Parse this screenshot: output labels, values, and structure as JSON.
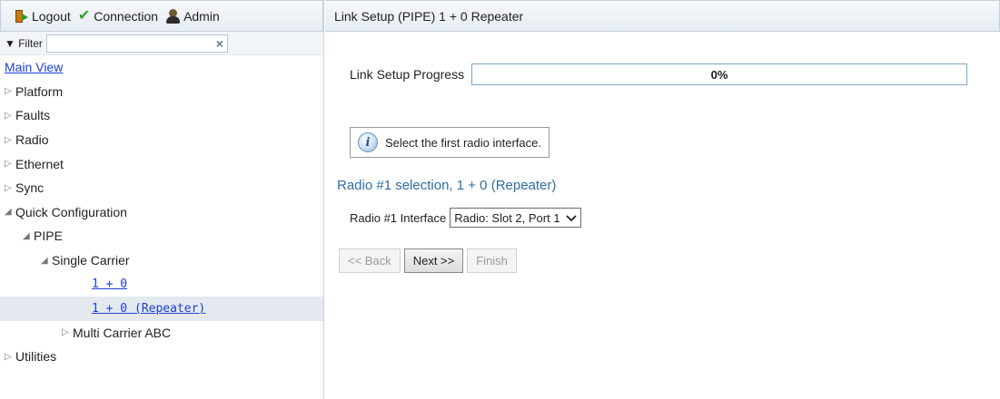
{
  "toolbar": {
    "logout_label": "Logout",
    "connection_label": "Connection",
    "admin_label": "Admin"
  },
  "filter": {
    "label": "▼ Filter",
    "value": "",
    "placeholder": "",
    "clear_glyph": "×"
  },
  "tree": {
    "main_view": "Main View",
    "platform": "Platform",
    "faults": "Faults",
    "radio": "Radio",
    "ethernet": "Ethernet",
    "sync": "Sync",
    "quick_config": "Quick Configuration",
    "pipe": "PIPE",
    "single_carrier": "Single Carrier",
    "one_plus_zero": "1 + 0",
    "one_plus_zero_repeater": "1 + 0 (Repeater)",
    "multi_carrier": "Multi Carrier ABC",
    "utilities": "Utilities",
    "expanded_glyph": "◢",
    "collapsed_glyph": "▷",
    "selected_item": "1 + 0 (Repeater)"
  },
  "page": {
    "title": "Link Setup (PIPE) 1 + 0 Repeater",
    "progress_label": "Link Setup Progress",
    "progress_text": "0%",
    "progress_value": 0,
    "info_message": "Select the first radio interface.",
    "section_title": "Radio #1 selection, 1 + 0 (Repeater)",
    "interface_label": "Radio #1 Interface",
    "interface_value": "Radio: Slot 2, Port 1",
    "back_label": "<< Back",
    "next_label": "Next >>",
    "finish_label": "Finish"
  },
  "colors": {
    "link": "#1a3fd6",
    "section_title": "#2e6da0",
    "selected_row": "#e4e9ef",
    "progress_border": "#7ba7c9"
  },
  "icons": {
    "logout": "logout-door-icon",
    "connection": "checkmark-icon",
    "admin": "admin-user-icon",
    "info": "info-icon",
    "filter_clear": "close-icon",
    "select": "chevron-down-icon"
  }
}
